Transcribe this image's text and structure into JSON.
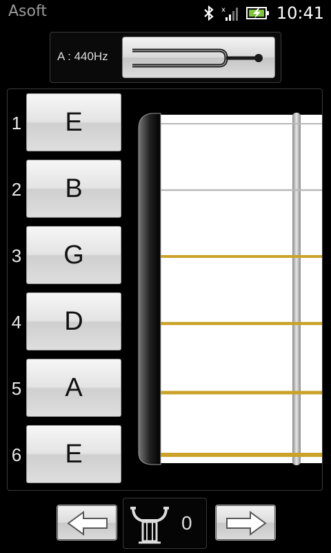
{
  "statusbar": {
    "app_name": "Asoft",
    "time": "10:41",
    "icons": [
      "bluetooth-icon",
      "signal-icon",
      "battery-charging-icon"
    ]
  },
  "tuner": {
    "reference": "A : 440Hz",
    "fork_icon": "tuning-fork-icon"
  },
  "strings": [
    {
      "number": "1",
      "note": "E",
      "type": "plain"
    },
    {
      "number": "2",
      "note": "B",
      "type": "plain"
    },
    {
      "number": "3",
      "note": "G",
      "type": "wound"
    },
    {
      "number": "4",
      "note": "D",
      "type": "wound"
    },
    {
      "number": "5",
      "note": "A",
      "type": "wound"
    },
    {
      "number": "6",
      "note": "E",
      "type": "wound"
    }
  ],
  "colors": {
    "plain_string": "#b8b8b8",
    "wound_string": "#c9a227",
    "button_text": "#111111"
  },
  "controls": {
    "prev_icon": "arrow-left-icon",
    "next_icon": "arrow-right-icon",
    "capo_icon": "capo-icon",
    "capo_value": "0"
  }
}
